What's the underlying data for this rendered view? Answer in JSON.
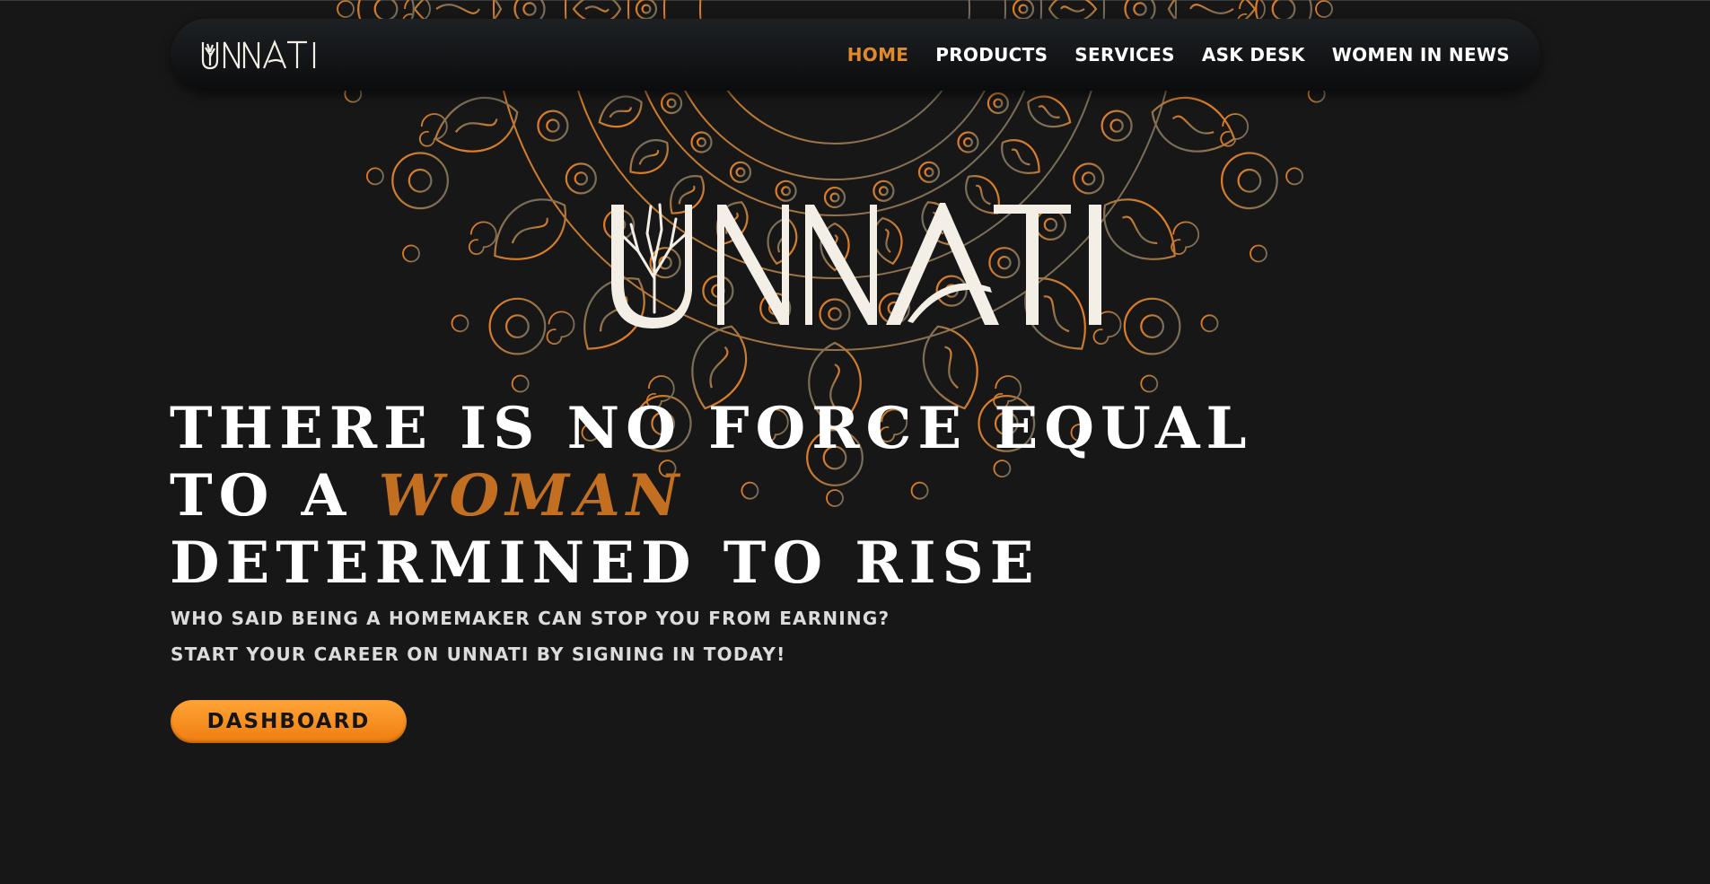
{
  "nav": {
    "logo_text": "UNNATI",
    "items": [
      {
        "label": "HOME",
        "active": true
      },
      {
        "label": "PRODUCTS",
        "active": false
      },
      {
        "label": "SERVICES",
        "active": false
      },
      {
        "label": "ASK DESK",
        "active": false
      },
      {
        "label": "WOMEN IN NEWS",
        "active": false
      }
    ]
  },
  "hero": {
    "logo_text": "UNNATI",
    "headline_line1": "THERE IS NO FORCE EQUAL",
    "headline_line2_prefix": "TO A ",
    "headline_line2_accent": "WOMAN",
    "headline_line3": "DETERMINED TO RISE",
    "subtitle_line1": "WHO SAID BEING A HOMEMAKER CAN STOP YOU FROM EARNING?",
    "subtitle_line2": "START YOUR CAREER ON UNNATI BY SIGNING IN TODAY!",
    "button_label": "DASHBOARD"
  },
  "colors": {
    "background": "#171717",
    "accent_orange": "#e08a2c",
    "headline_accent": "#c26f22",
    "button_orange": "#f7901f",
    "logo_cream": "#f3efe6"
  }
}
